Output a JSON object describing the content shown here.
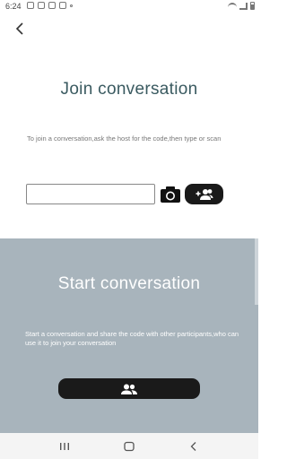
{
  "status_bar": {
    "time": "6:24",
    "left_icons": [
      "messenger-icon",
      "voicemail-icon",
      "image-icon",
      "news-icon",
      "dot-icon"
    ],
    "right_icons": [
      "wifi-icon",
      "signal-icon",
      "battery-icon"
    ]
  },
  "header": {
    "back_icon": "chevron-left-icon"
  },
  "join": {
    "title": "Join conversation",
    "description": "To join a conversation,ask the host for the code,then type or scan",
    "code_input_value": "",
    "code_input_placeholder": "",
    "scan_icon": "camera-icon",
    "join_icon": "add-group-icon"
  },
  "start": {
    "title": "Start conversation",
    "description": "Start a conversation and share the code with other participants,who can use it to join your conversation",
    "start_icon": "group-icon"
  },
  "nav_bar": {
    "icons": [
      "recents-icon",
      "home-icon",
      "back-icon"
    ]
  },
  "colors": {
    "join_title": "#3a5a60",
    "start_panel_bg": "#a8b4bc",
    "button_bg": "#1a1a1a",
    "nav_bg": "#f4f4f4"
  }
}
